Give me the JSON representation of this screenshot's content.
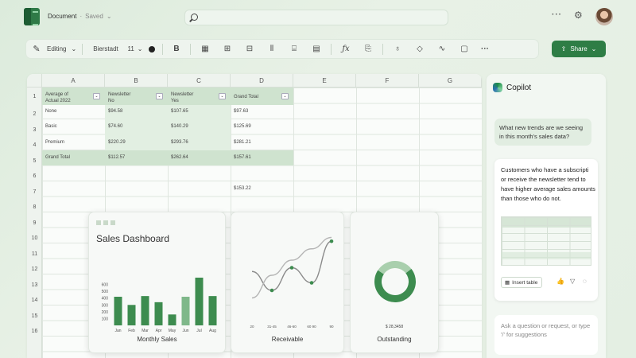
{
  "app": {
    "document_name": "Document",
    "save_status": "Saved",
    "search_placeholder": ""
  },
  "ribbon": {
    "mode": "Editing",
    "font": "Bierstadt",
    "font_size": "11",
    "bold": "B",
    "share": "Share"
  },
  "grid": {
    "columns": [
      "A",
      "B",
      "C",
      "D",
      "E",
      "F",
      "G"
    ],
    "rows": [
      "1",
      "2",
      "3",
      "4",
      "5",
      "6",
      "7",
      "8",
      "9",
      "10",
      "11",
      "12",
      "13",
      "14",
      "15",
      "16"
    ]
  },
  "pivot": {
    "headers": [
      "Average of\nActual 2022",
      "Newsletter\nNo",
      "Newsletter\nYes",
      "Grand Total"
    ],
    "rows": [
      [
        "None",
        "$94.58",
        "$107.65",
        "$97.63"
      ],
      [
        "Basic",
        "$74.60",
        "$140.29",
        "$125.69"
      ],
      [
        "Premium",
        "$220.29",
        "$293.76",
        "$281.21"
      ],
      [
        "Grand Total",
        "$112.57",
        "$262.64",
        "$157.61"
      ]
    ],
    "extra": "$153.22"
  },
  "dashboard": {
    "title": "Sales Dashboard",
    "cap1": "Monthly Sales",
    "cap2": "Receivable",
    "cap3": "Outstanding",
    "donut_value": "$ 28,3458"
  },
  "chart_data": [
    {
      "type": "bar",
      "title": "Sales Dashboard",
      "xlabel": "Monthly Sales",
      "categories": [
        "Jan",
        "Feb",
        "Mar",
        "Apr",
        "May",
        "Jun",
        "Jul",
        "Aug"
      ],
      "values": [
        420,
        300,
        430,
        340,
        160,
        420,
        720,
        430
      ],
      "yticks": [
        100,
        200,
        300,
        400,
        500,
        600
      ],
      "highlight_indices": [
        6
      ]
    },
    {
      "type": "line",
      "xlabel": "Receivable",
      "xticks": [
        "20",
        "31-45",
        "46-60",
        "60 90",
        "90"
      ],
      "series": [
        {
          "values": [
            0.45,
            0.2,
            0.5,
            0.3,
            0.85
          ]
        },
        {
          "values": [
            0.1,
            0.4,
            0.6,
            0.75,
            0.9
          ]
        }
      ]
    },
    {
      "type": "pie",
      "xlabel": "Outstanding",
      "values": [
        70,
        30
      ],
      "colors": [
        "#3d8c4f",
        "#a9cfad"
      ]
    }
  ],
  "copilot": {
    "title": "Copilot",
    "question": "What new trends are we seeing in this month's sales data?",
    "response": "Customers who have a subscripti\nor receive the newsletter tend to\nhave higher average sales amounts\nthan those who do not.",
    "insert_table": "Insert table",
    "ask_placeholder": "Ask a question or request, or type '/' for suggestions"
  },
  "colors": {
    "accent": "#2e7d45",
    "pivot_header": "#cfe3cf"
  }
}
